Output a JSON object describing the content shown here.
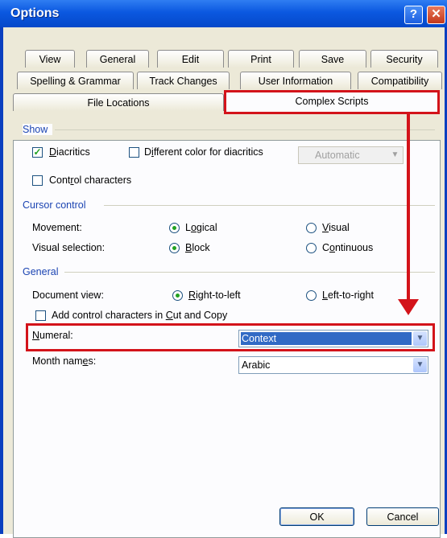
{
  "window": {
    "title": "Options",
    "help_glyph": "?",
    "close_glyph": "✕"
  },
  "tabs": {
    "row1": [
      "View",
      "General",
      "Edit",
      "Print",
      "Save",
      "Security"
    ],
    "row2": [
      "Spelling & Grammar",
      "Track Changes",
      "User Information",
      "Compatibility"
    ],
    "row3": [
      "File Locations",
      "Complex Scripts"
    ],
    "active": "Complex Scripts"
  },
  "show": {
    "title": "Show",
    "diacritics": {
      "label": "Diacritics",
      "checked": true
    },
    "diff_color": {
      "label": "Different color for diacritics",
      "checked": false
    },
    "color_select": {
      "value": "Automatic",
      "disabled": true
    },
    "control_chars": {
      "label": "Control characters",
      "checked": false
    }
  },
  "cursor": {
    "title": "Cursor control",
    "movement_label": "Movement:",
    "movement_options": [
      "Logical",
      "Visual"
    ],
    "movement_selected": "Logical",
    "visual_label": "Visual selection:",
    "visual_options": [
      "Block",
      "Continuous"
    ],
    "visual_selected": "Block"
  },
  "general": {
    "title": "General",
    "docview_label": "Document view:",
    "docview_options": [
      "Right-to-left",
      "Left-to-right"
    ],
    "docview_selected": "Right-to-left",
    "cut_copy": {
      "label": "Add control characters in Cut and Copy",
      "checked": false
    },
    "numeral_label": "Numeral:",
    "numeral_value": "Context",
    "month_label": "Month names:",
    "month_value": "Arabic"
  },
  "buttons": {
    "ok": "OK",
    "cancel": "Cancel"
  },
  "colors": {
    "highlight_red": "#d3131a",
    "group_blue": "#1b44b2",
    "selection": "#316ac5"
  }
}
